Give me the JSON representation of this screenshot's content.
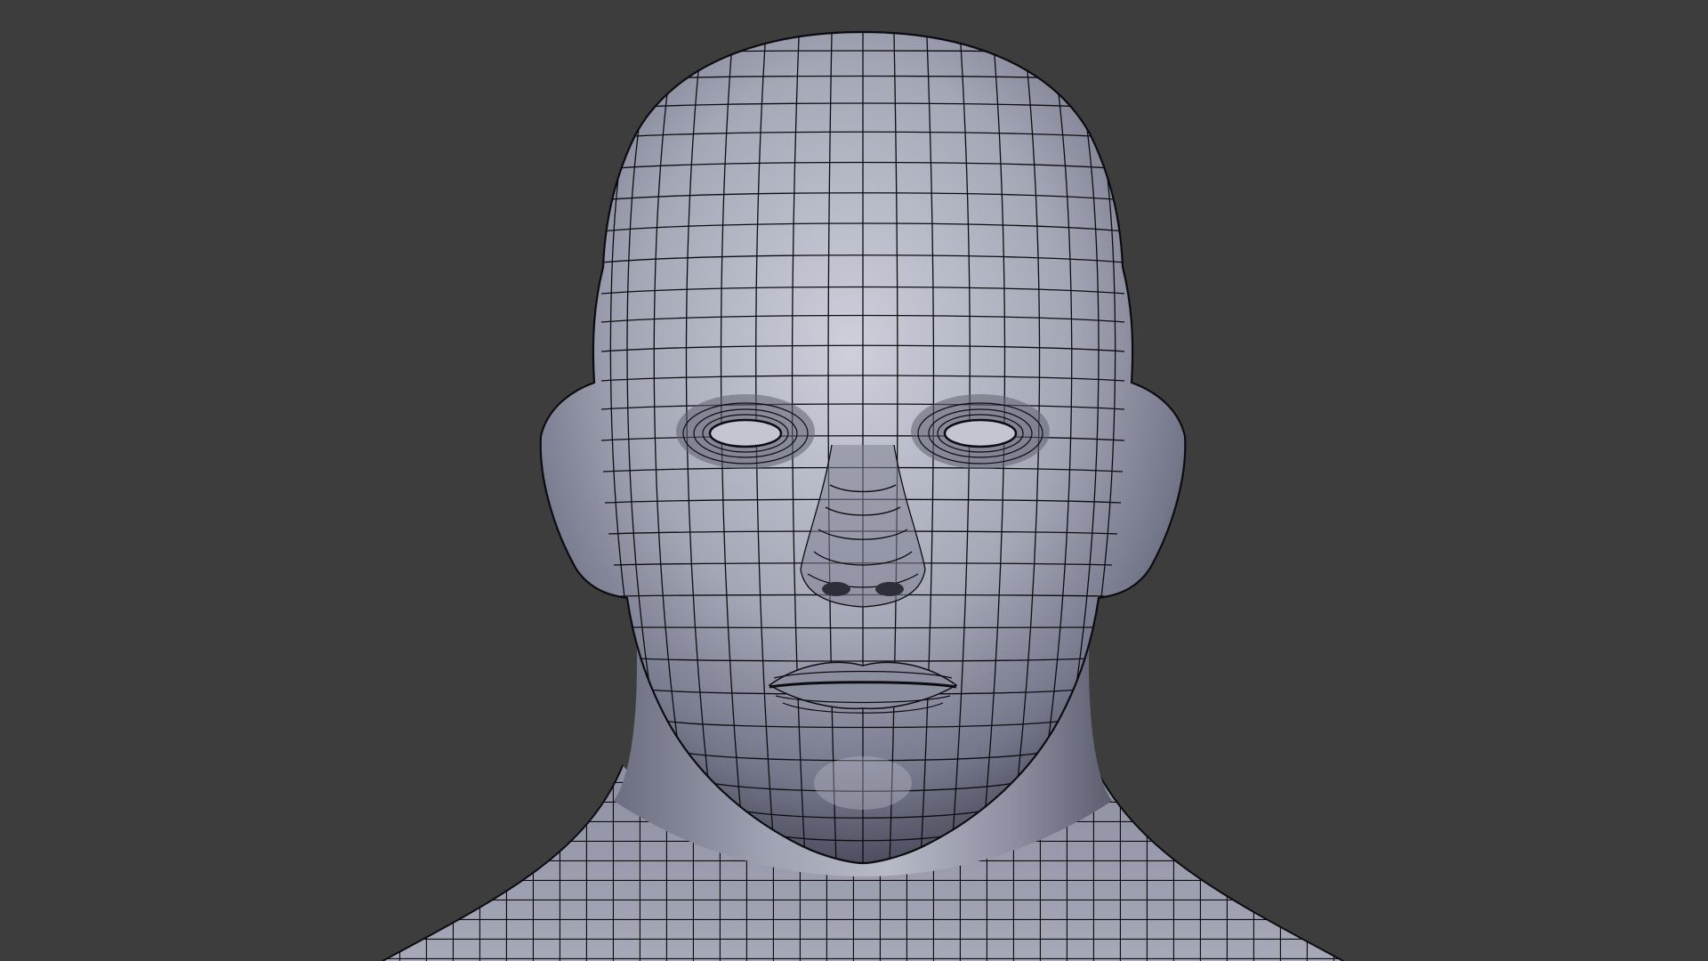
{
  "viewport": {
    "background_color": "#3d3d3d",
    "view_mode": "wireframe-overlay",
    "subject": "head-bust-mesh",
    "colors": {
      "surface_light": "#c9cbd6",
      "surface_mid": "#9a9caa",
      "surface_dark": "#55576a",
      "wire": "#0c0c10"
    }
  }
}
